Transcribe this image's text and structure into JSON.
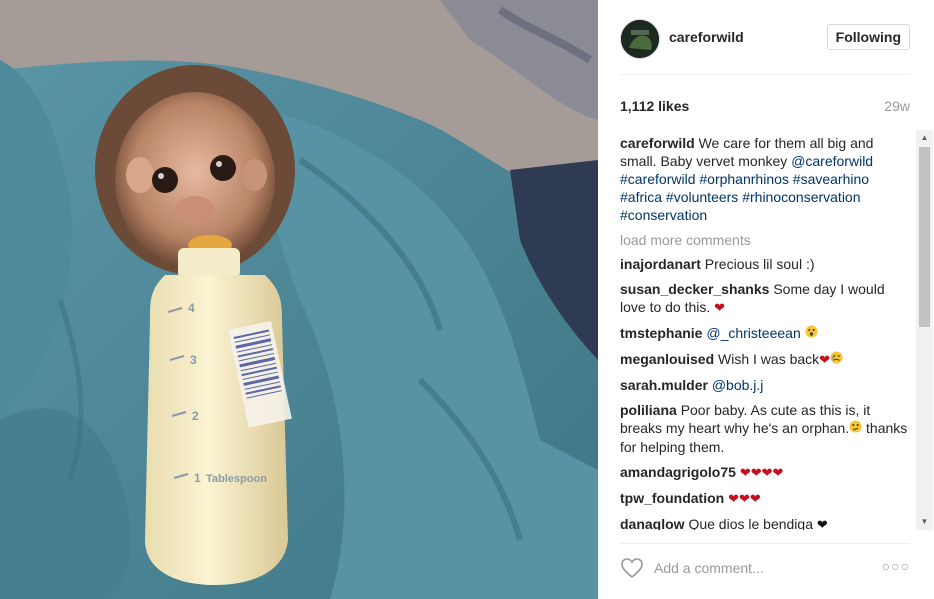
{
  "post": {
    "username": "careforwild",
    "follow_label": "Following",
    "likes": "1,112 likes",
    "age": "29w"
  },
  "caption": {
    "user": "careforwild",
    "text": "We care for them all big and small. Baby vervet monkey",
    "tags": [
      "@careforwild",
      "#careforwild",
      "#orphanrhinos",
      "#savearhino",
      "#africa",
      "#volunteers",
      "#rhinoconservation",
      "#conservation"
    ]
  },
  "load_more": "load more comments",
  "comments": [
    {
      "user": "inajordanart",
      "text": "Precious lil soul :)"
    },
    {
      "user": "susan_decker_shanks",
      "text": "Some day I would love to do this."
    },
    {
      "user": "tmstephanie",
      "mention": "@_christeeean"
    },
    {
      "user": "meganlouised",
      "text": "Wish I was back"
    },
    {
      "user": "sarah.mulder",
      "mention": "@bob.j.j"
    },
    {
      "user": "poliliana",
      "text": "Poor baby. As cute as this is, it breaks my heart why he's an orphan.",
      "text2": "thanks for helping them."
    },
    {
      "user": "amandagrigolo75",
      "text": "❤❤❤❤"
    },
    {
      "user": "tpw_foundation",
      "text": "❤❤❤"
    },
    {
      "user": "danaglow",
      "text": "Que dios le bendiga"
    }
  ],
  "add_comment_placeholder": "Add a comment...",
  "photo": {
    "bottle_marks": [
      "4",
      "3",
      "2",
      "1",
      "Tablespoon"
    ]
  },
  "icons": {
    "like": "heart-outline-icon",
    "more": "ellipsis-icon",
    "scroll_up": "triangle-up",
    "scroll_down": "triangle-down"
  },
  "colors": {
    "link": "#003569",
    "muted": "#999999",
    "heart": "#c40f1d"
  }
}
